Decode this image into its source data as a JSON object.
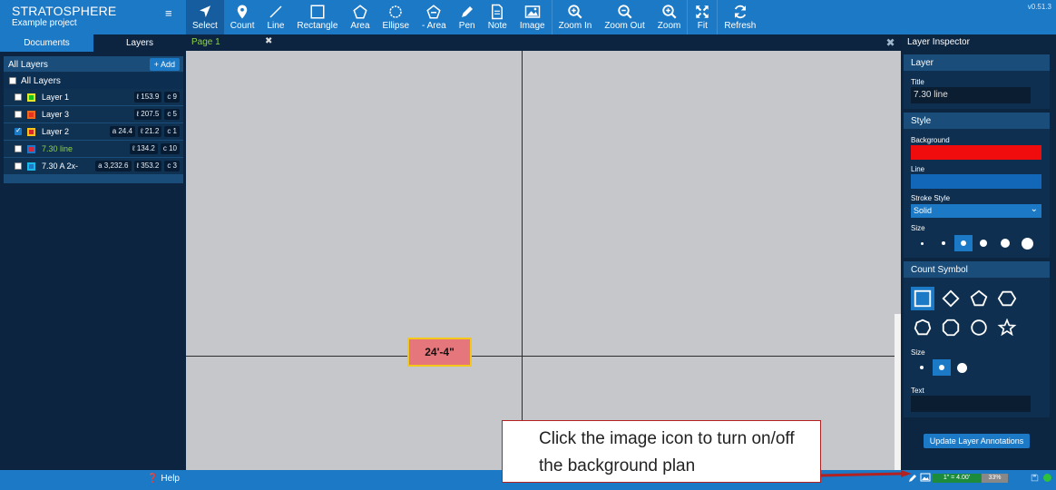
{
  "app": {
    "name": "STRATOSPHERE",
    "project": "Example project",
    "version": "v0.51.3"
  },
  "toolbar": [
    {
      "label": "Select",
      "icon": "cursor-arrow-icon",
      "active": true
    },
    {
      "label": "Count",
      "icon": "map-pin-icon"
    },
    {
      "label": "Line",
      "icon": "line-icon"
    },
    {
      "label": "Rectangle",
      "icon": "rectangle-icon"
    },
    {
      "label": "Area",
      "icon": "pentagon-icon"
    },
    {
      "label": "Ellipse",
      "icon": "ellipse-icon"
    },
    {
      "label": "- Area",
      "icon": "subtract-area-icon"
    },
    {
      "label": "Pen",
      "icon": "pen-icon"
    },
    {
      "label": "Note",
      "icon": "note-icon"
    },
    {
      "label": "Image",
      "icon": "image-icon"
    },
    {
      "label": "Zoom In",
      "icon": "zoom-in-icon"
    },
    {
      "label": "Zoom Out",
      "icon": "zoom-out-icon"
    },
    {
      "label": "Zoom",
      "icon": "zoom-icon"
    },
    {
      "label": "Fit",
      "icon": "fit-expand-icon"
    },
    {
      "label": "Refresh",
      "icon": "refresh-icon"
    }
  ],
  "left_panel": {
    "tabs": {
      "documents": "Documents",
      "layers": "Layers"
    },
    "header": "All Layers",
    "add_label": "+ Add",
    "all_label": "All Layers",
    "layers": [
      {
        "name": "Layer 1",
        "color": "#19c319",
        "border": "#e6e62c",
        "checked": false,
        "stats": [
          "ℓ 153.9",
          "c 9"
        ]
      },
      {
        "name": "Layer 3",
        "color": "#e8341e",
        "border": "#e86d1e",
        "checked": false,
        "stats": [
          "ℓ 207.5",
          "c 5"
        ]
      },
      {
        "name": "Layer 2",
        "color": "#d92727",
        "border": "#f0c419",
        "checked": true,
        "stats": [
          "a 24.4",
          "ℓ 21.2",
          "c 1"
        ]
      },
      {
        "name": "7.30 line",
        "color": "#d6283a",
        "border": "#1c79c6",
        "checked": false,
        "highlight": true,
        "stats": [
          "ℓ 134.2",
          "c 10"
        ]
      },
      {
        "name": "7.30 A 2x-",
        "color": "#1c79c6",
        "border": "#19b8e6",
        "checked": false,
        "stats": [
          "a 3,232.6",
          "ℓ 353.2",
          "c 3"
        ]
      }
    ],
    "help_label": "Help"
  },
  "canvas": {
    "page_tab": "Page 1",
    "dimension_label": "24'-4\""
  },
  "inspector": {
    "title": "Layer Inspector",
    "layer_section": "Layer",
    "title_label": "Title",
    "title_value": "7.30 line",
    "style_section": "Style",
    "background_label": "Background",
    "background_color": "#f00c0c",
    "line_label": "Line",
    "line_color": "#1267b8",
    "stroke_style_label": "Stroke Style",
    "stroke_style_value": "Solid",
    "size_label": "Size",
    "count_symbol_section": "Count Symbol",
    "count_size_label": "Size",
    "text_label": "Text",
    "update_button": "Update Layer Annotations"
  },
  "status_bar": {
    "scale": "1\" = 4.00'",
    "zoom": "33%"
  },
  "callout": {
    "text": "Click the image icon to turn on/off the background plan"
  }
}
